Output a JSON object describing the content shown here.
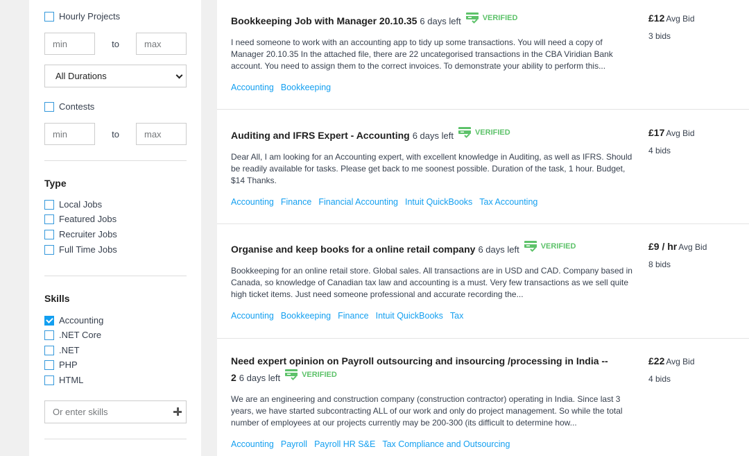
{
  "filters": {
    "hourly": {
      "label": "Hourly Projects",
      "checked": false
    },
    "hourly_min_placeholder": "min",
    "hourly_max_placeholder": "max",
    "to_label": "to",
    "duration_selected": "All Durations",
    "contests": {
      "label": "Contests",
      "checked": false
    },
    "contest_min_placeholder": "min",
    "contest_max_placeholder": "max",
    "type_title": "Type",
    "types": [
      {
        "label": "Local Jobs",
        "checked": false
      },
      {
        "label": "Featured Jobs",
        "checked": false
      },
      {
        "label": "Recruiter Jobs",
        "checked": false
      },
      {
        "label": "Full Time Jobs",
        "checked": false
      }
    ],
    "skills_title": "Skills",
    "skills": [
      {
        "label": "Accounting",
        "checked": true
      },
      {
        "label": ".NET Core",
        "checked": false
      },
      {
        "label": ".NET",
        "checked": false
      },
      {
        "label": "PHP",
        "checked": false
      },
      {
        "label": "HTML",
        "checked": false
      }
    ],
    "skill_input_placeholder": "Or enter skills"
  },
  "verified_label": "VERIFIED",
  "avg_bid_label": "Avg Bid",
  "jobs": [
    {
      "title": "Bookkeeping Job with Manager 20.10.35",
      "days_left": "6 days left",
      "description": "I need someone to work with an accounting app to tidy up some transactions. You will need a copy of Manager 20.10.35 In the attached file, there are 22 uncategorised transactions in the CBA Viridian Bank account. You need to assign them to the correct invoices. To demonstrate your ability to perform this...",
      "tags": [
        "Accounting",
        "Bookkeeping"
      ],
      "price": "£12",
      "bids": "3 bids"
    },
    {
      "title": "Auditing and IFRS Expert - Accounting",
      "days_left": "6 days left",
      "description": "Dear All, I am looking for an Accounting expert, with excellent knowledge in Auditing, as well as IFRS. Should be readily available for tasks. Please get back to me soonest possible. Duration of the task, 1 hour. Budget, $14 Thanks.",
      "tags": [
        "Accounting",
        "Finance",
        "Financial Accounting",
        "Intuit QuickBooks",
        "Tax Accounting"
      ],
      "price": "£17",
      "bids": "4 bids"
    },
    {
      "title": "Organise and keep books for a online retail company",
      "days_left": "6 days left",
      "description": "Bookkeeping for an online retail store. Global sales. All transactions are in USD and CAD. Company based in Canada, so knowledge of Canadian tax law and accounting is a must. Very few transactions as we sell quite high ticket items. Just need someone professional and accurate recording the...",
      "tags": [
        "Accounting",
        "Bookkeeping",
        "Finance",
        "Intuit QuickBooks",
        "Tax"
      ],
      "price": "£9 / hr",
      "bids": "8 bids"
    },
    {
      "title": "Need expert opinion on Payroll outsourcing and insourcing /processing in India -- 2",
      "days_left": "6 days left",
      "description": "We are an engineering and construction company (construction contractor) operating in India. Since last 3 years, we have started subcontracting ALL of our work and only do project management. So while the total number of employees at our projects currently may be 200-300 (its difficult to determine how...",
      "tags": [
        "Accounting",
        "Payroll",
        "Payroll HR S&E",
        "Tax Compliance and Outsourcing"
      ],
      "price": "£22",
      "bids": "4 bids"
    }
  ],
  "colors": {
    "accent": "#139ff0",
    "verified": "#5dc26a"
  }
}
